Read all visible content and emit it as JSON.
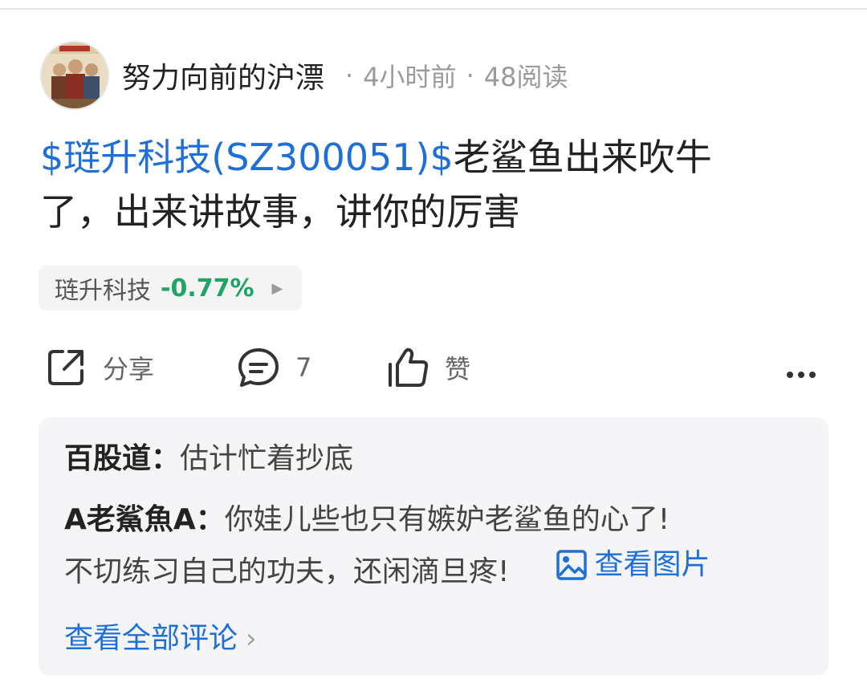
{
  "post": {
    "author": "努力向前的沪漂",
    "time": "4小时前",
    "reads": "48阅读",
    "meta_sep": "·",
    "stock_tag": "$琏升科技(SZ300051)$",
    "text_line1": "老鲨鱼出来吹牛",
    "text_line2": "了，出来讲故事，讲你的厉害"
  },
  "stock_chip": {
    "name": "琏升科技",
    "change": "-0.77%",
    "arrow": "▶",
    "change_color": "#21a366"
  },
  "actions": {
    "share_label": "分享",
    "comment_count": "7",
    "like_label": "赞"
  },
  "comments": {
    "items": [
      {
        "author": "百股道：",
        "text": "估计忙着抄底"
      },
      {
        "author": "A老鯊魚A：",
        "text_line1": "你娃儿些也只有嫉妒老鲨鱼的心了!",
        "text_line2": "不切练习自己的功夫，还闲滴旦疼!"
      }
    ],
    "view_image": "查看图片",
    "view_all": "查看全部评论",
    "chevron": "›"
  },
  "colors": {
    "link": "#1f6fd8",
    "positive": "#21a366",
    "muted": "#9a9a9a"
  },
  "icons": {
    "avatar": "avatar-image",
    "share": "share-icon",
    "comment": "comment-icon",
    "like": "thumbs-up-icon",
    "more": "more-icon",
    "image": "image-icon"
  }
}
